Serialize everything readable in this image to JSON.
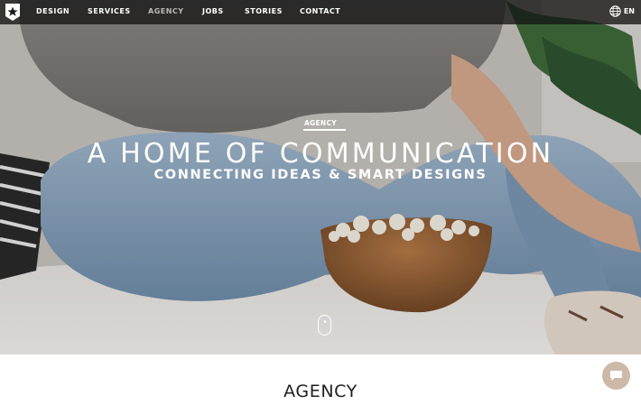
{
  "nav": {
    "items": [
      {
        "label": "DESIGN",
        "active": false
      },
      {
        "label": "SERVICES",
        "active": false
      },
      {
        "label": "AGENCY",
        "active": true
      },
      {
        "label": "JOBS",
        "active": false
      },
      {
        "label": "STORIES",
        "active": false
      },
      {
        "label": "CONTACT",
        "active": false
      }
    ],
    "language": "EN",
    "language_icon": "globe-icon",
    "logo_icon": "star-badge-icon"
  },
  "hero": {
    "eyebrow": "AGENCY",
    "headline": "A HOME OF COMMUNICATION",
    "subline": "CONNECTING IDEAS & SMART DESIGNS",
    "scroll_icon": "mouse-scroll-icon"
  },
  "section": {
    "title": "AGENCY"
  },
  "chat": {
    "icon": "chat-bubble-icon",
    "color": "#cdb9a8"
  }
}
